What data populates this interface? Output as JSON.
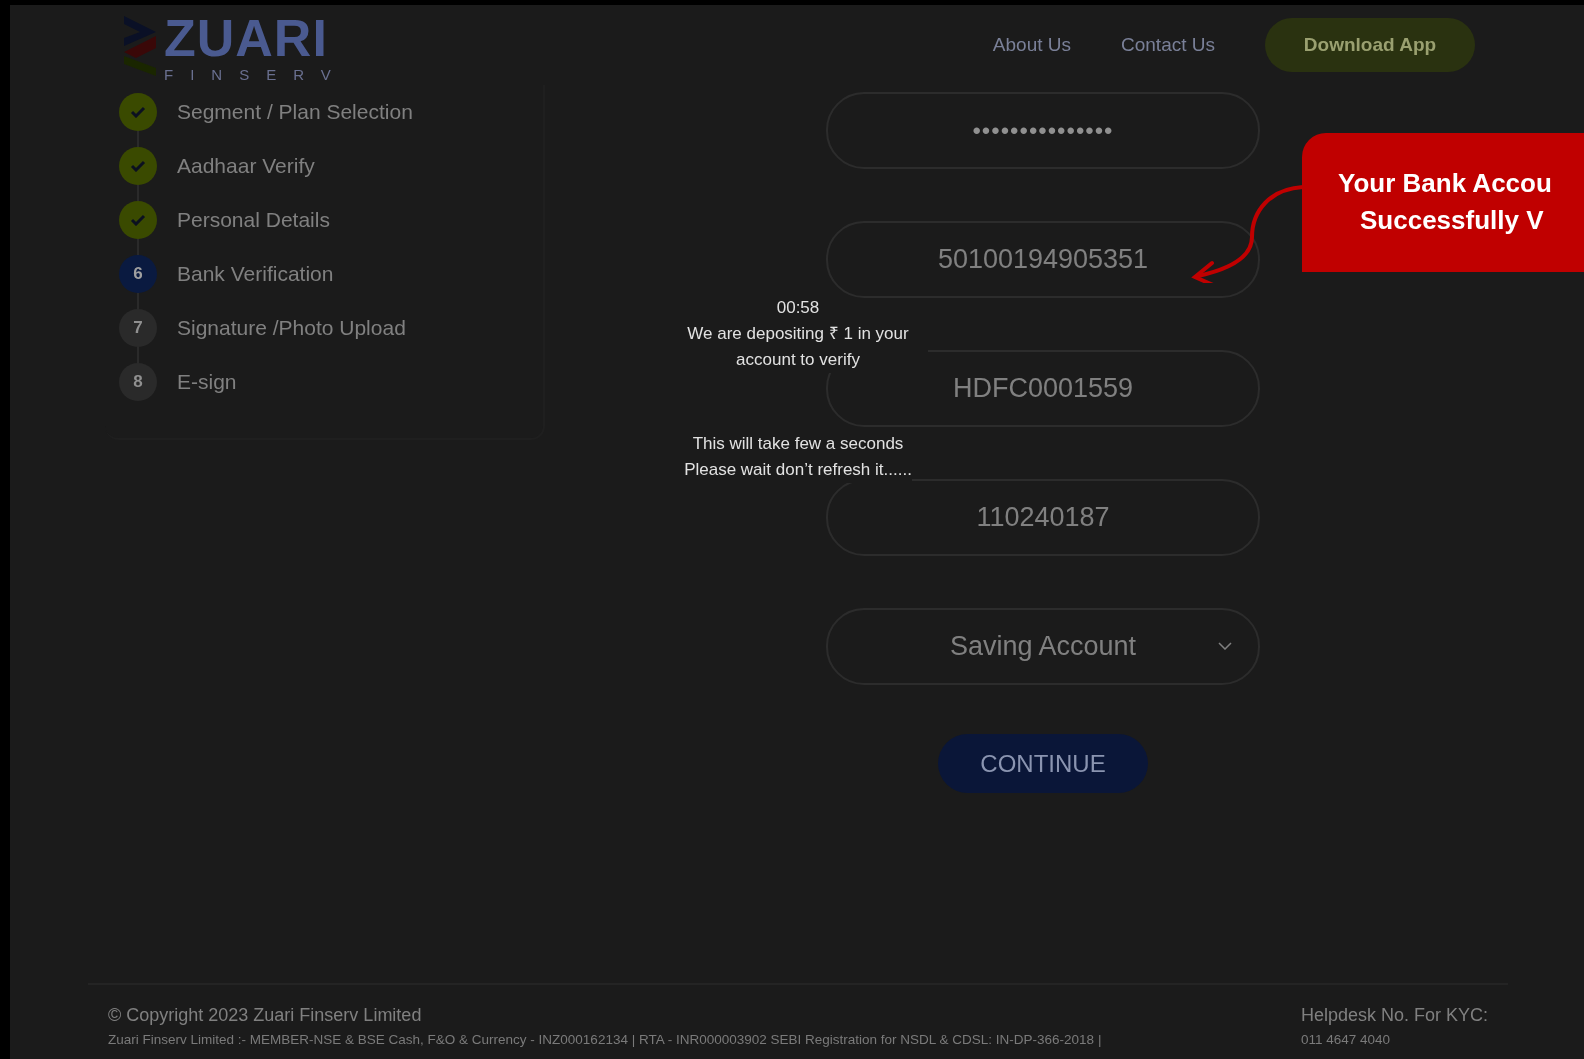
{
  "header": {
    "logo": {
      "name": "ZUARI",
      "tagline": "FINSERV"
    },
    "nav": [
      {
        "label": "About Us"
      },
      {
        "label": "Contact Us"
      }
    ],
    "download_button": "Download App"
  },
  "steps": [
    {
      "label": "Segment / Plan Selection",
      "completed": true,
      "selected": false
    },
    {
      "label": "Aadhaar Verify",
      "completed": true,
      "selected": false
    },
    {
      "label": "Personal Details",
      "completed": true,
      "selected": false
    },
    {
      "number": "6",
      "label": "Bank Verification",
      "completed": false,
      "selected": true
    },
    {
      "number": "7",
      "label": "Signature /Photo Upload",
      "completed": false,
      "selected": false
    },
    {
      "number": "8",
      "label": "E-sign",
      "completed": false,
      "selected": false
    }
  ],
  "form": {
    "fields": [
      {
        "kind": "text",
        "value": "•••••••••••••••"
      },
      {
        "kind": "text",
        "value": "50100194905351"
      },
      {
        "kind": "text",
        "value": "HDFC0001559"
      },
      {
        "kind": "text",
        "value": "110240187"
      },
      {
        "kind": "select",
        "value": "Saving Account"
      }
    ],
    "continue_button": "CONTINUE"
  },
  "loading_message": {
    "timer": "00:58",
    "text": "We are depositing ₹ 1 in your account to verify",
    "notes": [
      "This will take few a seconds",
      "Please wait don’t refresh it......"
    ]
  },
  "callout": {
    "lines": [
      "Your Bank Accou",
      "Successfully V"
    ]
  },
  "footer": {
    "copyright": "© Copyright 2023 Zuari Finserv Limited",
    "disclosure": "Zuari Finserv Limited :- MEMBER-NSE & BSE Cash, F&O & Currency - INZ000162134 | RTA - INR000003902 SEBI Registration for NSDL & CDSL: IN-DP-366-2018 |",
    "helpdesk_label": "Helpdesk No. For KYC:",
    "helpdesk_number": "011 4647 4040"
  }
}
